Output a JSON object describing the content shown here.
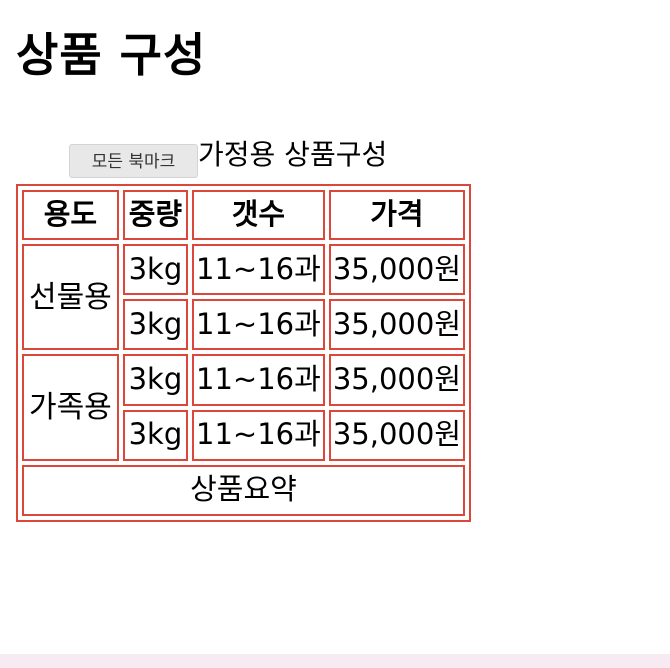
{
  "page": {
    "title": "상품 구성",
    "caption_prefix": "<",
    "caption": "가정용 상품구성",
    "tooltip": "모든 북마크"
  },
  "table": {
    "headers": [
      "용도",
      "중량",
      "갯수",
      "가격"
    ],
    "groups": [
      {
        "name": "선물용",
        "rows": [
          {
            "weight": "3kg",
            "count": "11~16과",
            "price": "35,000원"
          },
          {
            "weight": "3kg",
            "count": "11~16과",
            "price": "35,000원"
          }
        ]
      },
      {
        "name": "가족용",
        "rows": [
          {
            "weight": "3kg",
            "count": "11~16과",
            "price": "35,000원"
          },
          {
            "weight": "3kg",
            "count": "11~16과",
            "price": "35,000원"
          }
        ]
      }
    ],
    "summary": "상품요약"
  },
  "colors": {
    "table_border": "#d9483b",
    "tooltip_bg": "#e8e8e8",
    "bottom_strip": "#f7eaf2"
  }
}
